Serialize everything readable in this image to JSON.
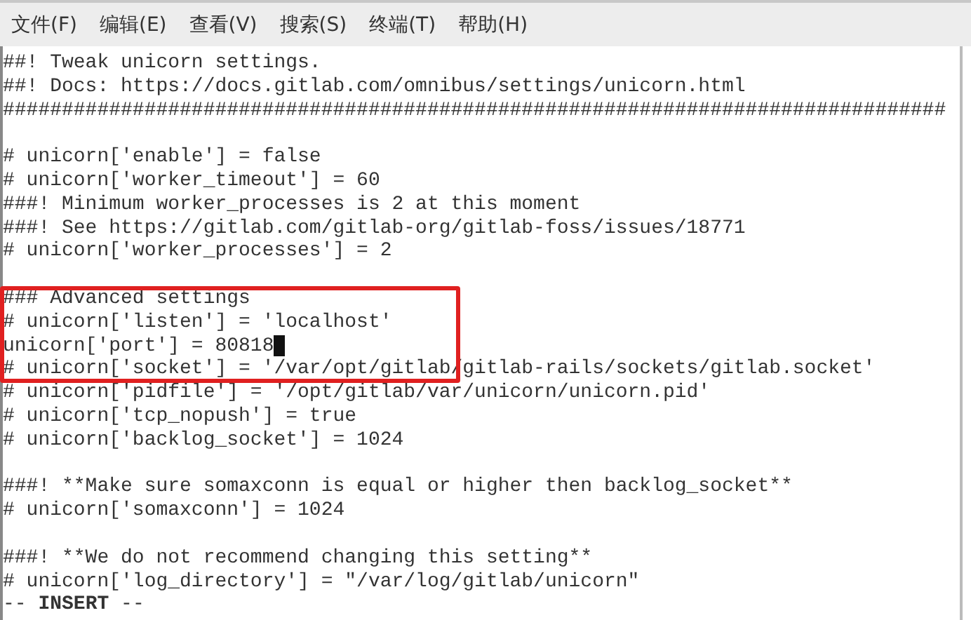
{
  "menu_bar": {
    "items": [
      {
        "label": "文件(F)"
      },
      {
        "label": "编辑(E)"
      },
      {
        "label": "查看(V)"
      },
      {
        "label": "搜索(S)"
      },
      {
        "label": "终端(T)"
      },
      {
        "label": "帮助(H)"
      }
    ]
  },
  "editor": {
    "lines": [
      {
        "text": "##! Tweak unicorn settings.",
        "highlighted": false,
        "cursor": false
      },
      {
        "text": "##! Docs: https://docs.gitlab.com/omnibus/settings/unicorn.html",
        "highlighted": false,
        "cursor": false
      },
      {
        "text": "################################################################################",
        "highlighted": false,
        "cursor": false
      },
      {
        "highlighted": false,
        "cursor": false
      },
      {
        "text": "# unicorn['enable'] = false",
        "highlighted": false,
        "cursor": false
      },
      {
        "text": "# unicorn['worker_timeout'] = 60",
        "highlighted": false,
        "cursor": false
      },
      {
        "text": "###! Minimum worker_processes is 2 at this moment",
        "highlighted": false,
        "cursor": false
      },
      {
        "text": "###! See https://gitlab.com/gitlab-org/gitlab-foss/issues/18771",
        "highlighted": false,
        "cursor": false
      },
      {
        "text": "# unicorn['worker_processes'] = 2",
        "highlighted": false,
        "cursor": false
      },
      {
        "highlighted": false,
        "cursor": false
      },
      {
        "text": "### Advanced settings",
        "highlighted": true,
        "cursor": false
      },
      {
        "text": "# unicorn['listen'] = 'localhost'",
        "highlighted": true,
        "cursor": false
      },
      {
        "text": "unicorn['port'] = 80818",
        "highlighted": true,
        "cursor": true
      },
      {
        "text": "# unicorn['socket'] = '/var/opt/gitlab/gitlab-rails/sockets/gitlab.socket'",
        "highlighted": true,
        "cursor": false
      },
      {
        "text": "# unicorn['pidfile'] = '/opt/gitlab/var/unicorn/unicorn.pid'",
        "highlighted": false,
        "cursor": false
      },
      {
        "text": "# unicorn['tcp_nopush'] = true",
        "highlighted": false,
        "cursor": false
      },
      {
        "text": "# unicorn['backlog_socket'] = 1024",
        "highlighted": false,
        "cursor": false
      },
      {
        "highlighted": false,
        "cursor": false
      },
      {
        "text": "###! **Make sure somaxconn is equal or higher then backlog_socket**",
        "highlighted": false,
        "cursor": false
      },
      {
        "text": "# unicorn['somaxconn'] = 1024",
        "highlighted": false,
        "cursor": false
      },
      {
        "highlighted": false,
        "cursor": false
      },
      {
        "text": "###! **We do not recommend changing this setting**",
        "highlighted": false,
        "cursor": false
      },
      {
        "text": "# unicorn['log_directory'] = \"/var/log/gitlab/unicorn\"",
        "highlighted": false,
        "cursor": false
      }
    ],
    "mode_line": "-- **INSERT** --"
  }
}
